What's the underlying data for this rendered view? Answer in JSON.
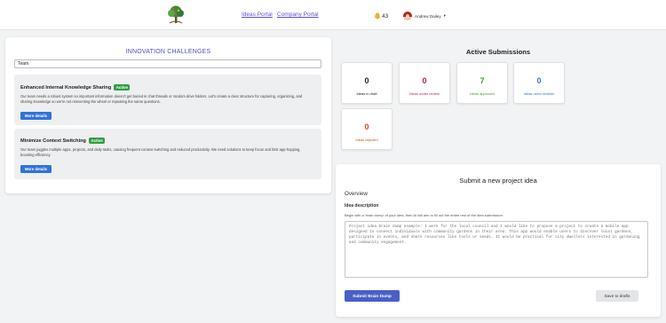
{
  "header": {
    "nav": {
      "ideas_portal": "Ideas Portal",
      "company_portal": "Company Portal"
    },
    "notifications": {
      "count": "43",
      "icon": "bell-icon"
    },
    "user": {
      "name": "Andrew Dailey",
      "caret": "▾"
    }
  },
  "challenges": {
    "title": "INNOVATION CHALLENGES",
    "search_value": "Team",
    "items": [
      {
        "title": "Enhanced Internal Knowledge Sharing",
        "status": "Active",
        "description": "Our team needs a robust system so important information doesn't get buried in chat threads or random drive folders. Let's create a clear structure for capturing, organizing, and sharing knowledge so we're not reinventing the wheel or repeating the same questions.",
        "button": "More details"
      },
      {
        "title": "Minimize Context Switching",
        "status": "Active",
        "description": "Our team juggles multiple apps, projects, and daily tasks, causing frequent context switching and reduced productivity. We need solutions to keep focus and limit app-hopping, boosting efficiency.",
        "button": "More details"
      }
    ]
  },
  "submissions": {
    "title": "Active Submissions",
    "stats": [
      {
        "value": "0",
        "label": "Ideas in draft",
        "color": "#222222"
      },
      {
        "value": "0",
        "label": "Ideas under review",
        "color": "#c2185b"
      },
      {
        "value": "7",
        "label": "Ideas approved",
        "color": "#3d9a2f"
      },
      {
        "value": "0",
        "label": "Ideas need revision",
        "color": "#2f73d9"
      },
      {
        "value": "0",
        "label": "Ideas rejected",
        "color": "#e0452b"
      }
    ]
  },
  "submit": {
    "title": "Submit a new project idea",
    "overview": "Overview",
    "idea_label": "Idea description",
    "idea_help": "Begin with a 'brain dump' of your idea, then AI will aim to fill out the entire rest of the idea submission",
    "idea_text": "Project idea brain dump example: I work for the local council and I would like to propose a project to create a mobile app designed to connect individuals with community gardens in their area. This app would enable users to discover local gardens, participate in events, and share resources like tools or seeds. It would be practical for city dwellers interested in gardening and community engagement.",
    "brain_dump_button": "Submit Brain Dump",
    "save_button": "Save to drafts"
  }
}
